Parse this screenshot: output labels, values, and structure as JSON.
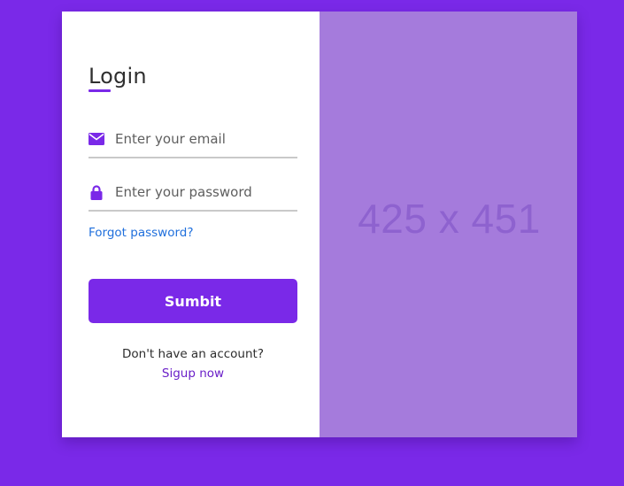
{
  "login": {
    "title": "Login",
    "email_placeholder": "Enter your email",
    "password_placeholder": "Enter your password",
    "forgot_label": "Forgot password?",
    "submit_label": "Sumbit",
    "signup_prompt": "Don't have an account?",
    "signup_link": "Sigup now"
  },
  "image_placeholder": {
    "label": "425 x 451"
  },
  "icons": {
    "email": "envelope-icon",
    "password": "lock-icon"
  },
  "colors": {
    "background": "#7a29e8",
    "accent": "#7a29e8",
    "image_panel": "#a57bdc",
    "link": "#1f6fdc",
    "signup_link": "#6a1fc8"
  }
}
